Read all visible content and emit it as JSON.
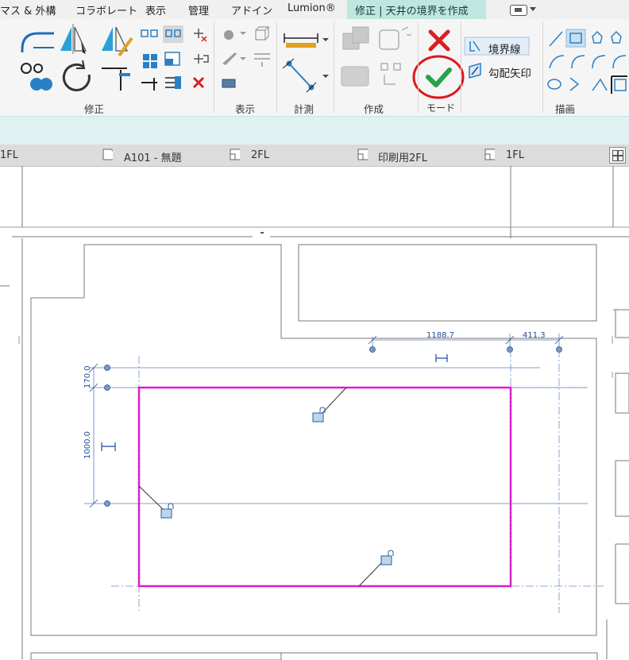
{
  "menu": {
    "items": [
      "マス & 外構",
      "コラボレート",
      "表示",
      "管理",
      "アドイン",
      "Lumion®"
    ],
    "context_tab": "修正 | 天井の境界を作成"
  },
  "ribbon": {
    "panels": {
      "modify": "修正",
      "view": "表示",
      "measure": "計測",
      "create": "作成",
      "mode": "モード",
      "draw": "描画"
    },
    "draw_tools": {
      "boundary_line": "境界線",
      "slope_arrow": "勾配矢印"
    }
  },
  "view_tabs": [
    "1FL",
    "A101 - 無題",
    "2FL",
    "印刷用2FL",
    "1FL"
  ],
  "dimensions": {
    "top_left": "1188.7",
    "top_right": "411.3",
    "left_top": "170.0",
    "left_main": "1000.0"
  },
  "colors": {
    "boundary": "#e81bd8",
    "dimension": "#1f4e9b",
    "finish": "#2aa14a",
    "cancel": "#d92020",
    "highlight_circle": "#e0151a"
  }
}
